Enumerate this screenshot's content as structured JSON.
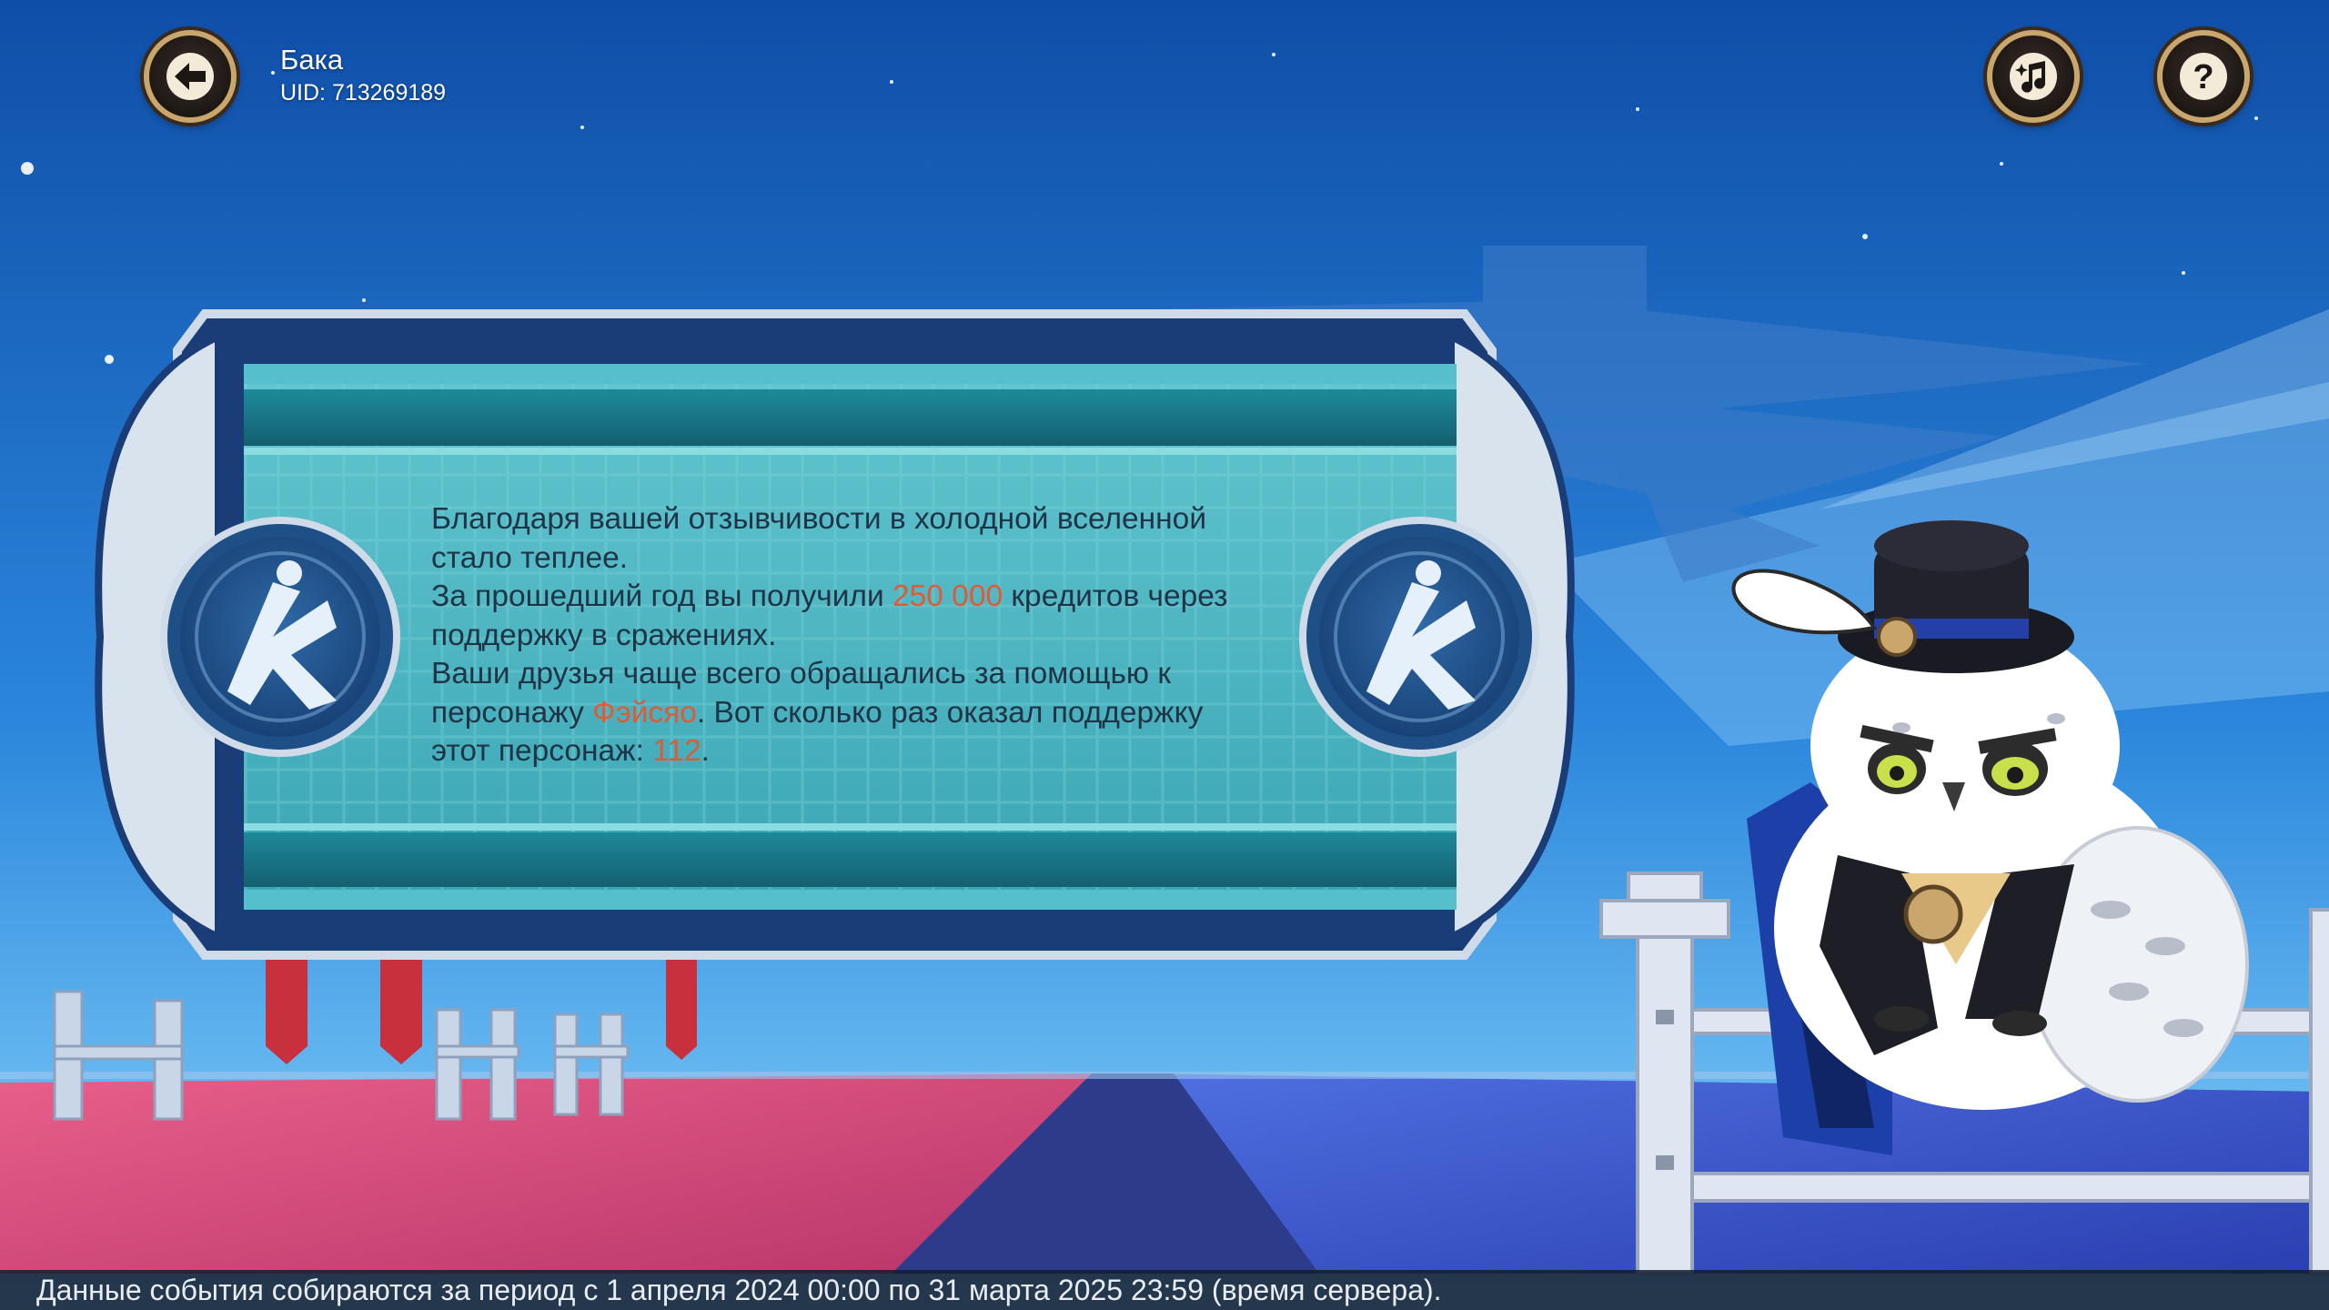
{
  "header": {
    "user_name": "Бака",
    "user_uid": "UID: 713269189"
  },
  "icons": {
    "back": "back-arrow-icon",
    "music": "music-note-icon",
    "help": "question-mark-icon"
  },
  "message": {
    "line1": "Благодаря вашей отзывчивости в холодной вселенной",
    "line2": "стало теплее.",
    "line3_before": "За прошедший год вы получили ",
    "credits": "250 000",
    "line3_after": " кредитов через",
    "line4": "поддержку в сражениях.",
    "line5": "Ваши друзья чаще всего обращались за помощью к",
    "line6_before": "персонажу ",
    "character": "Фэйсяо",
    "line6_after": ". Вот сколько раз оказал поддержку",
    "line7_before": "этот персонаж: ",
    "count": "112",
    "line7_after": "."
  },
  "footer": {
    "text": "Данные события собираются за период с 1 апреля 2024 00:00 по 31 марта 2025 23:59 (время сервера)."
  },
  "colors": {
    "highlight": "#e05a35",
    "button_ring": "#c9a66b",
    "panel_teal": "#4bb8c4"
  }
}
